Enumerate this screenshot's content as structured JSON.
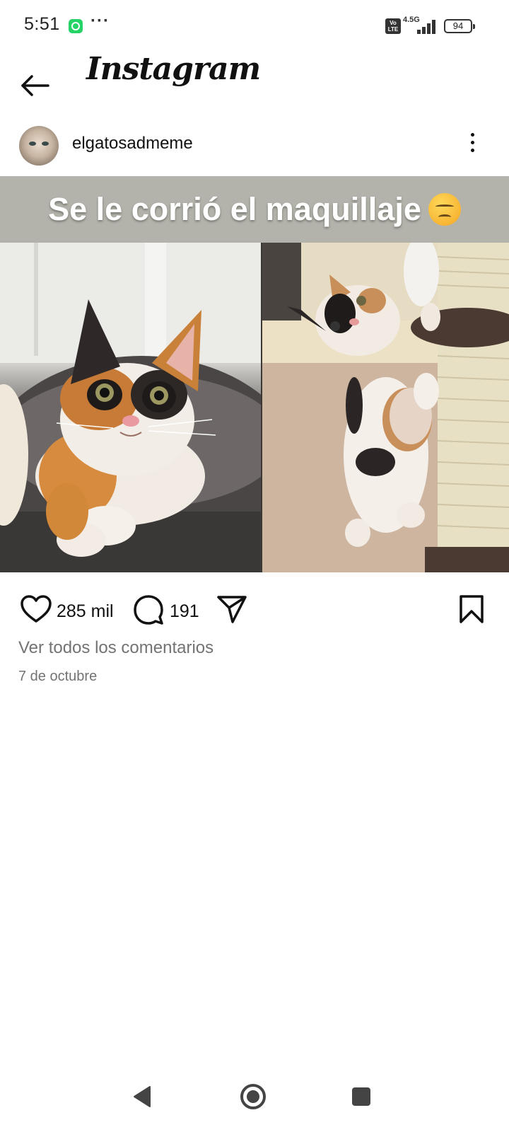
{
  "status_bar": {
    "time": "5:51",
    "notification_icons": [
      "whatsapp-icon",
      "more-dots-icon"
    ],
    "more_dots": "···",
    "volte_line1": "Vo",
    "volte_line2": "LTE",
    "network": "4.5G",
    "battery_level": "94"
  },
  "header": {
    "back_icon": "arrow-left-icon",
    "brand": "Instagram"
  },
  "post": {
    "username": "elgatosadmeme",
    "caption_overlay": "Se le corrió el maquillaje",
    "caption_emoji": "disappointed-face-emoji",
    "photos": [
      {
        "subject": "calico kitten lying in a grey cat bed"
      },
      {
        "subject": "calico kitten standing against a sisal scratching post"
      }
    ],
    "likes": "285 mil",
    "comments": "191",
    "view_comments_label": "Ver todos los comentarios",
    "date": "7 de octubre"
  },
  "nav": {
    "icons": [
      "back-triangle-icon",
      "home-circle-icon",
      "recents-square-icon"
    ]
  },
  "colors": {
    "caption_band": "#b3b3ab",
    "secondary_text": "#737373",
    "text": "#111111"
  }
}
